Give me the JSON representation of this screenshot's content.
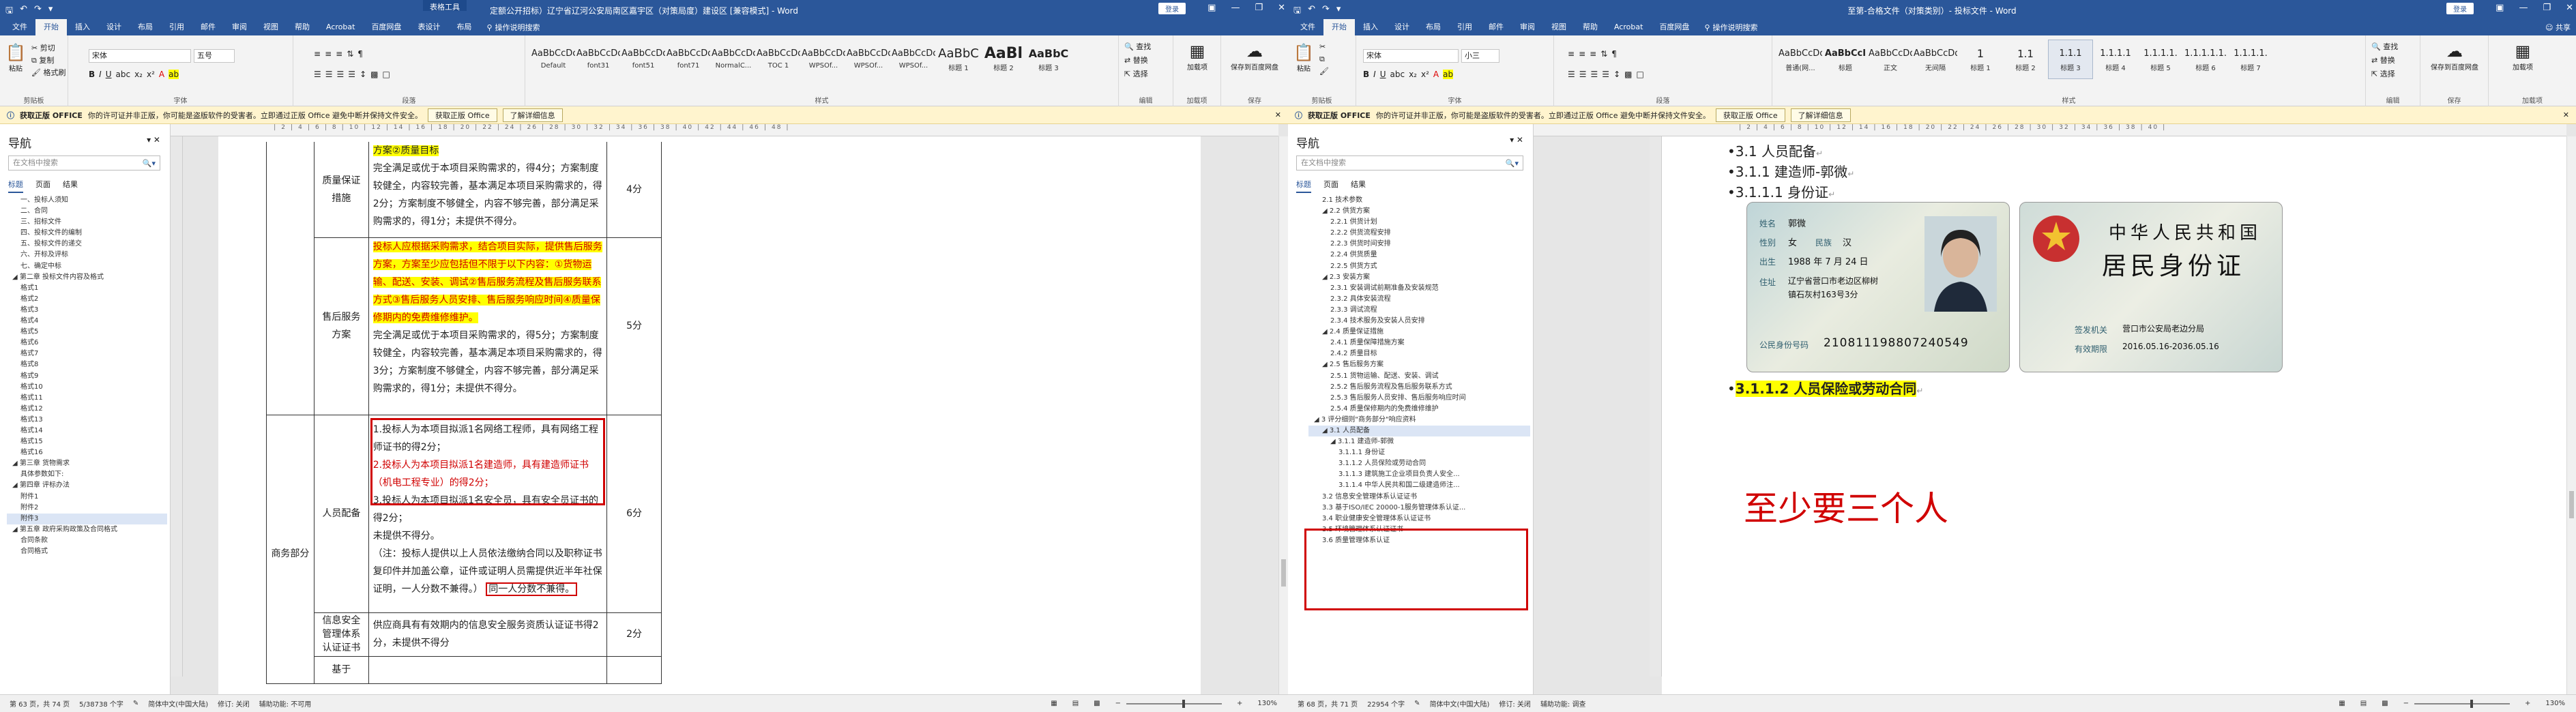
{
  "left": {
    "title": "定额公开招标）辽宁省辽河公安局南区嘉宇区（对策局度）建设区 [兼容模式] - Word",
    "contextual_tab": "表格工具",
    "login_label": "登录",
    "menu": [
      "文件",
      "开始",
      "插入",
      "设计",
      "布局",
      "引用",
      "邮件",
      "审阅",
      "视图",
      "帮助",
      "Acrobat",
      "百度网盘",
      "表设计",
      "布局"
    ],
    "tell_me": "操作说明搜索",
    "font_name": "宋体",
    "font_size": "五号",
    "styles": [
      {
        "preview": "AaBbCcDc",
        "name": "Default"
      },
      {
        "preview": "AaBbCcDd",
        "name": "font31"
      },
      {
        "preview": "AaBbCcDd",
        "name": "font51"
      },
      {
        "preview": "AaBbCcDd",
        "name": "font71"
      },
      {
        "preview": "AaBbCcDc",
        "name": "NormalC..."
      },
      {
        "preview": "AaBbCcDd",
        "name": "TOC 1"
      },
      {
        "preview": "AaBbCcDd",
        "name": "WPSOf..."
      },
      {
        "preview": "AaBbCcDd",
        "name": "WPSOf..."
      },
      {
        "preview": "AaBbCcDc",
        "name": "WPSOf..."
      },
      {
        "preview": "AaBbC",
        "name": "标题 1"
      },
      {
        "preview": "AaBl",
        "name": "标题 2"
      },
      {
        "preview": "AaBbC",
        "name": "标题 3"
      }
    ],
    "group_labels": [
      "剪贴板",
      "字体",
      "段落",
      "样式",
      "编辑",
      "加载项",
      "保存"
    ],
    "side_buttons": [
      "查找",
      "替换",
      "选择"
    ],
    "big_buttons": [
      {
        "label": "加载项"
      },
      {
        "label": "保存到百度网盘"
      }
    ],
    "clipboard": [
      "粘贴",
      "剪切",
      "复制",
      "格式刷"
    ],
    "infobar": {
      "bold": "获取正版 OFFICE",
      "text": "你的许可证并非正版，你可能是盗版软件的受害者。立即通过正版 Office 避免中断并保持文件安全。",
      "btn1": "获取正版 Office",
      "btn2": "了解详细信息"
    },
    "nav": {
      "title": "导航",
      "search_placeholder": "在文档中搜索",
      "tabs": [
        "标题",
        "页面",
        "结果"
      ],
      "items": [
        "一、投标人须知",
        "二、合同",
        "三、招标文件",
        "四、投标文件的编制",
        "五、投标文件的递交",
        "六、开标及评标",
        "七、确定中标",
        "◢ 第二章 投标文件内容及格式",
        "格式1",
        "格式2",
        "格式3",
        "格式4",
        "格式5",
        "格式6",
        "格式7",
        "格式8",
        "格式9",
        "格式10",
        "格式11",
        "格式12",
        "格式13",
        "格式14",
        "格式15",
        "格式16",
        "◢ 第三章 货物需求",
        "具体参数如下:",
        "◢ 第四章 评标办法",
        "附件1",
        "附件2",
        "附件3",
        "◢ 第五章 政府采购政策及合同格式",
        "合同条款",
        "合同格式"
      ],
      "selected_index": 29
    },
    "table": {
      "r1_label": "质量保证措施",
      "r1_hl": "方案②质量目标",
      "r1_text": "完全满足或优于本项目采购需求的，得4分；方案制度较健全，内容较完善，基本满足本项目采购需求的，得2分；方案制度不够健全，内容不够完善，部分满足采购需求的，得1分；未提供不得分。",
      "r1_score": "4分",
      "r2_label": "售后服务方案",
      "r2_hl": "投标人应根据采购需求，结合项目实际，提供售后服务方案，方案至少应包括但不限于以下内容：①货物运输、配送、安装、调试②售后服务流程及售后服务联系方式③售后服务人员安排、售后服务响应时间④质量保修期内的免费维修维护。",
      "r2_text": "完全满足或优于本项目采购需求的，得5分；方案制度较健全，内容较完善，基本满足本项目采购需求的，得3分；方案制度不够健全，内容不够完善，部分满足采购需求的，得1分；未提供不得分。",
      "r2_score": "5分",
      "r3_group": "商务部分",
      "r3_label": "人员配备",
      "r3_l1": "1.投标人为本项目拟派1名网络工程师，具有网络工程师证书的得2分；",
      "r3_l2": "2.投标人为本项目拟派1名建造师，具有建造师证书（机电工程专业）的得2分；",
      "r3_l3": "3.投标人为本项目拟派1名安全员，具有安全员证书的得2分；",
      "r3_l4": "未提供不得分。",
      "r3_l5": "（注：投标人提供以上人员依法缴纳合同以及职称证书复印件并加盖公章，证件或证明人员需提供近半年社保证明，一人分数不兼得。）",
      "r3_l5_box": "同一人分数不兼得。",
      "r3_score": "6分",
      "r4_label": "信息安全管理体系认证证书",
      "r4_text": "供应商具有有效期内的信息安全服务资质认证证书得2分，未提供不得分",
      "r4_score": "2分",
      "r5_label": "基于"
    },
    "status": {
      "page": "第 63 页，共 74 页",
      "words": "5/38738 个字",
      "lang": "简体中文(中国大陆)",
      "revise": "修订: 关闭",
      "access": "辅助功能: 不可用",
      "zoom": "130%"
    }
  },
  "right": {
    "title": "至第-合格文件（对策类别）- 投标文件 - Word",
    "login_label": "登录",
    "menu": [
      "文件",
      "开始",
      "插入",
      "设计",
      "布局",
      "引用",
      "邮件",
      "审阅",
      "视图",
      "帮助",
      "Acrobat",
      "百度网盘",
      "操作说明搜索"
    ],
    "share": "共享",
    "font_name": "宋体",
    "font_size": "小三",
    "styles": [
      {
        "preview": "AaBbCcDc",
        "name": "普通(网..."
      },
      {
        "preview": "AaBbCcI",
        "name": "标题"
      },
      {
        "preview": "AaBbCcDd",
        "name": "正文"
      },
      {
        "preview": "AaBbCcDd",
        "name": "无间隔"
      },
      {
        "preview": "1",
        "name": "标题 1"
      },
      {
        "preview": "1.1",
        "name": "标题 2"
      },
      {
        "preview": "1.1.1",
        "name": "标题 3"
      },
      {
        "preview": "1.1.1.1",
        "name": "标题 4"
      },
      {
        "preview": "1.1.1.1.",
        "name": "标题 5"
      },
      {
        "preview": "1.1.1.1.1.",
        "name": "标题 6"
      },
      {
        "preview": "1.1.1.1.",
        "name": "标题 7"
      }
    ],
    "group_labels": [
      "剪贴板",
      "字体",
      "段落",
      "样式",
      "编辑",
      "保存",
      "加载项"
    ],
    "side_buttons": [
      "查找",
      "替换",
      "选择"
    ],
    "big_buttons": [
      {
        "label": "保存到百度网盘"
      },
      {
        "label": "加载项"
      }
    ],
    "infobar": {
      "bold": "获取正版 OFFICE",
      "text": "你的许可证并非正版，你可能是盗版软件的受害者。立即通过正版 Office 避免中断并保持文件安全。",
      "btn1": "获取正版 Office",
      "btn2": "了解详细信息"
    },
    "nav": {
      "title": "导航",
      "search_placeholder": "在文档中搜索",
      "tabs": [
        "标题",
        "页面",
        "结果"
      ],
      "items": [
        "2.1 技术参数",
        "◢ 2.2 供货方案",
        "2.2.1 供货计划",
        "2.2.2 供货流程安排",
        "2.2.3 供货时间安排",
        "2.2.4 供货质量",
        "2.2.5 供货方式",
        "◢ 2.3 安装方案",
        "2.3.1 安装调试前期准备及安装规范",
        "2.3.2 具体安装流程",
        "2.3.3 调试流程",
        "2.3.4 技术服务及安装人员安排",
        "◢ 2.4 质量保证措施",
        "2.4.1 质量保障措施方案",
        "2.4.2 质量目标",
        "◢ 2.5 售后服务方案",
        "2.5.1 货物运输、配送、安装、调试",
        "2.5.2 售后服务流程及售后服务联系方式",
        "2.5.3 售后服务人员安排、售后服务响应时间",
        "2.5.4 质量保修期内的免费维修维护",
        "◢ 3 评分细则\"商务部分\"响应资料",
        "◢ 3.1 人员配备",
        "◢ 3.1.1 建造师-郭微",
        "3.1.1.1 身份证",
        "3.1.1.2 人员保险或劳动合同",
        "3.1.1.3 建筑施工企业项目负责人安全...",
        "3.1.1.4 中华人民共和国二级建造师注...",
        "3.2 信息安全管理体系认证证书",
        "3.3 基于ISO/IEC 20000-1服务管理体系认证...",
        "3.4 职业健康安全管理体系认证证书",
        "3.5 环境管理体系认证证书",
        "3.6 质量管理体系认证"
      ],
      "selected_index": 21
    },
    "doc": {
      "h1": "3.1 人员配备",
      "h2": "3.1.1 建造师-郭微",
      "h3": "3.1.1.1 身份证",
      "h4": "3.1.1.2 人员保险或劳动合同",
      "note": "至少要三个人"
    },
    "idcard": {
      "name_label": "姓名",
      "name": "郭微",
      "sex_label": "性别",
      "sex": "女",
      "nation_label": "民族",
      "nation": "汉",
      "birth_label": "出生",
      "birth": "1988 年 7 月 24 日",
      "addr_label": "住址",
      "addr1": "辽宁省营口市老边区柳树",
      "addr2": "镇石灰村163号3分",
      "id_label": "公民身份号码",
      "id": "210811198807240549",
      "back_title1": "中华人民共和国",
      "back_title2": "居民身份证",
      "authority_label": "签发机关",
      "authority": "营口市公安局老边分局",
      "valid_label": "有效期限",
      "valid": "2016.05.16-2036.05.16"
    },
    "status": {
      "page": "第 68 页，共 71 页",
      "words": "22954 个字",
      "lang": "简体中文(中国大陆)",
      "revise": "修订: 关闭",
      "access": "辅助功能: 调查",
      "zoom": "130%"
    }
  }
}
